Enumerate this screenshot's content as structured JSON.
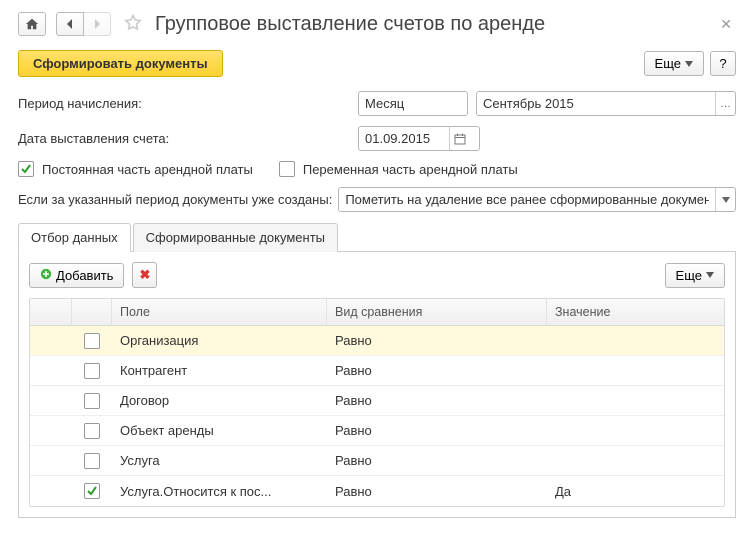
{
  "title": "Групповое выставление счетов по аренде",
  "toolbar": {
    "generate_label": "Сформировать документы",
    "more_label": "Еще",
    "help_label": "?"
  },
  "form": {
    "period_label": "Период начисления:",
    "period_type": "Месяц",
    "period_value": "Сентябрь 2015",
    "invoice_date_label": "Дата выставления счета:",
    "invoice_date": "01.09.2015",
    "fixed_part_label": "Постоянная часть арендной платы",
    "fixed_part_checked": true,
    "variable_part_label": "Переменная часть арендной платы",
    "variable_part_checked": false,
    "existing_docs_label": "Если за указанный период документы уже созданы:",
    "existing_docs_value": "Пометить на удаление все ранее сформированные документы"
  },
  "tabs": {
    "filter_label": "Отбор данных",
    "generated_label": "Сформированные документы"
  },
  "filter_panel": {
    "add_label": "Добавить",
    "more_label": "Еще"
  },
  "table": {
    "headers": {
      "check": "",
      "field": "Поле",
      "comparison": "Вид сравнения",
      "value": "Значение"
    },
    "rows": [
      {
        "checked": false,
        "selected": true,
        "field": "Организация",
        "comparison": "Равно",
        "value": ""
      },
      {
        "checked": false,
        "selected": false,
        "field": "Контрагент",
        "comparison": "Равно",
        "value": ""
      },
      {
        "checked": false,
        "selected": false,
        "field": "Договор",
        "comparison": "Равно",
        "value": ""
      },
      {
        "checked": false,
        "selected": false,
        "field": "Объект аренды",
        "comparison": "Равно",
        "value": ""
      },
      {
        "checked": false,
        "selected": false,
        "field": "Услуга",
        "comparison": "Равно",
        "value": ""
      },
      {
        "checked": true,
        "selected": false,
        "field": "Услуга.Относится к пос...",
        "comparison": "Равно",
        "value": "Да"
      }
    ]
  }
}
